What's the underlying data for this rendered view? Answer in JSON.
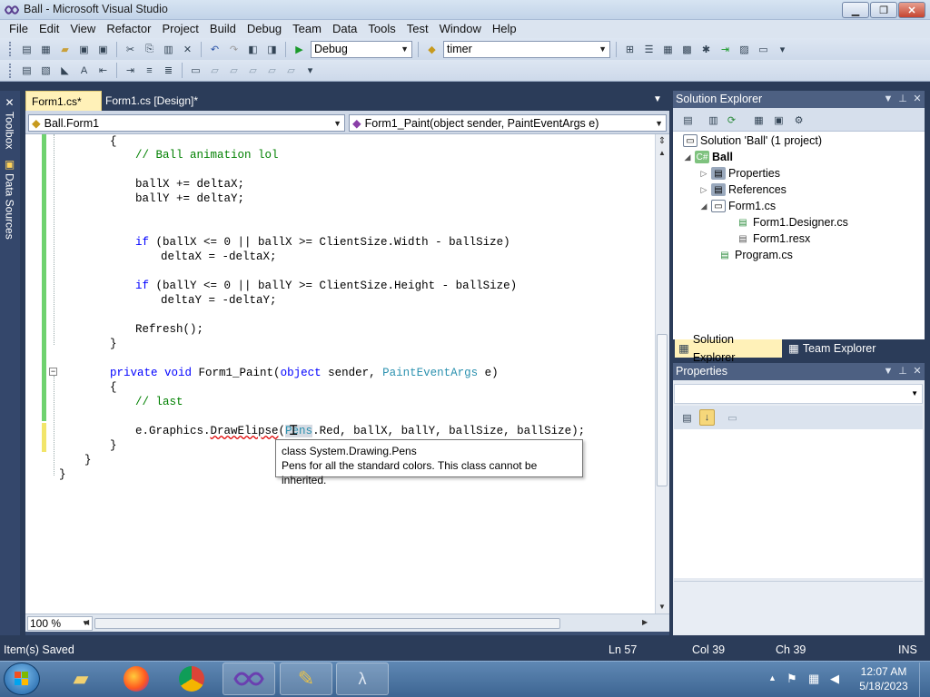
{
  "window": {
    "title": "Ball - Microsoft Visual Studio"
  },
  "menu": [
    "File",
    "Edit",
    "View",
    "Refactor",
    "Project",
    "Build",
    "Debug",
    "Team",
    "Data",
    "Tools",
    "Test",
    "Window",
    "Help"
  ],
  "toolbar": {
    "config_value": "Debug",
    "find_value": "timer"
  },
  "side_tabs": {
    "toolbox": "Toolbox",
    "data_sources": "Data Sources"
  },
  "doc_tabs": [
    {
      "label": "Form1.cs*"
    },
    {
      "label": "Form1.cs [Design]*"
    }
  ],
  "nav": {
    "class_value": "Ball.Form1",
    "member_value": "Form1_Paint(object sender, PaintEventArgs e)"
  },
  "code": {
    "l1": "{",
    "l2": "// Ball animation lol",
    "l3": "ballX += deltaX;",
    "l4": "ballY += deltaY;",
    "l5a": "if",
    "l5b": " (ballX <= 0 || ballX >= ClientSize.Width - ballSize)",
    "l6": "deltaX = -deltaX;",
    "l7a": "if",
    "l7b": " (ballY <= 0 || ballY >= ClientSize.Height - ballSize)",
    "l8": "deltaY = -deltaY;",
    "l9": "Refresh();",
    "l10": "}",
    "l11a": "private",
    "l11b": "void",
    "l11c": " Form1_Paint(",
    "l11d": "object",
    "l11e": " sender, ",
    "l11f": "PaintEventArgs",
    "l11g": " e)",
    "l12": "{",
    "l13": "// last",
    "l14a": "e.Graphics.",
    "l14b": "DrawElipse",
    "l14c": "(",
    "l14d": "Pens",
    "l14e": ".Red, ballX, ballY, ballSize, ballSize);",
    "l15": "}",
    "l16": "}",
    "l17": "}"
  },
  "tooltip": {
    "line1": "class System.Drawing.Pens",
    "line2": "Pens for all the standard colors. This class cannot be inherited."
  },
  "editor": {
    "zoom": "100 %"
  },
  "solution_explorer": {
    "title": "Solution Explorer",
    "items": [
      {
        "label": "Solution 'Ball' (1 project)"
      },
      {
        "label": "Ball"
      },
      {
        "label": "Properties"
      },
      {
        "label": "References"
      },
      {
        "label": "Form1.cs"
      },
      {
        "label": "Form1.Designer.cs"
      },
      {
        "label": "Form1.resx"
      },
      {
        "label": "Program.cs"
      }
    ],
    "tabs": [
      {
        "label": "Solution Explorer"
      },
      {
        "label": "Team Explorer"
      }
    ]
  },
  "properties": {
    "title": "Properties"
  },
  "status": {
    "message": "Item(s) Saved",
    "ln": "Ln 57",
    "col": "Col 39",
    "ch": "Ch 39",
    "mode": "INS"
  },
  "clock": {
    "time": "12:07 AM",
    "date": "5/18/2023"
  },
  "colors": {
    "accent": "#2b3c59",
    "active_tab": "#fff1b8",
    "keyword": "#0000ff",
    "comment": "#008000",
    "type": "#2b91af"
  }
}
